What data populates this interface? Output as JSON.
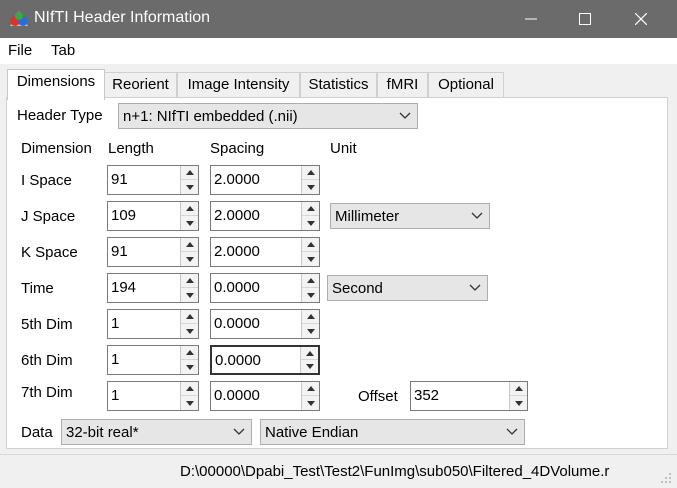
{
  "window": {
    "title": "NIfTI Header Information"
  },
  "menu": {
    "file": "File",
    "tab": "Tab"
  },
  "tabs": [
    {
      "label": "Dimensions",
      "active": true
    },
    {
      "label": "Reorient"
    },
    {
      "label": "Image Intensity"
    },
    {
      "label": "Statistics"
    },
    {
      "label": "fMRI"
    },
    {
      "label": "Optional"
    }
  ],
  "header_type": {
    "label": "Header Type",
    "value": "n+1: NIfTI   embedded (.nii)"
  },
  "columns": {
    "dimension": "Dimension",
    "length": "Length",
    "spacing": "Spacing",
    "unit": "Unit"
  },
  "rows": [
    {
      "label": "I Space",
      "length": "91",
      "spacing": "2.0000"
    },
    {
      "label": "J Space",
      "length": "109",
      "spacing": "2.0000",
      "unit": "Millimeter"
    },
    {
      "label": "K Space",
      "length": "91",
      "spacing": "2.0000"
    },
    {
      "label": "Time",
      "length": "194",
      "spacing": "0.0000",
      "unit": "Second"
    },
    {
      "label": "5th Dim",
      "length": "1",
      "spacing": "0.0000"
    },
    {
      "label": "6th Dim",
      "length": "1",
      "spacing": "0.0000"
    },
    {
      "label": "7th Dim",
      "length": "1",
      "spacing": "0.0000"
    }
  ],
  "offset": {
    "label": "Offset",
    "value": "352"
  },
  "data": {
    "label": "Data",
    "type": "32-bit real*",
    "endian": "Native Endian"
  },
  "status": {
    "path": "D:\\00000\\Dpabi_Test\\Test2\\FunImg\\sub050\\Filtered_4DVolume.r"
  }
}
